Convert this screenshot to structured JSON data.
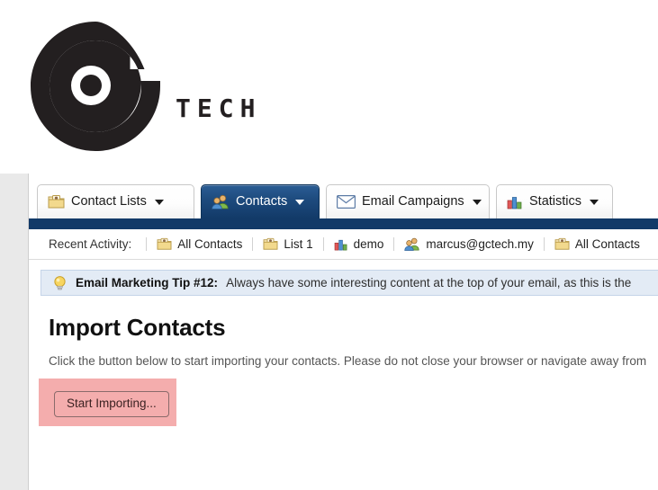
{
  "brand": {
    "logo_icon": "gtech-g-logo",
    "wordmark": "TECH"
  },
  "tabs": [
    {
      "label": "Contact Lists",
      "icon": "contact-list-folder-icon",
      "active": false,
      "has_caret": true
    },
    {
      "label": "Contacts",
      "icon": "contacts-people-icon",
      "active": true,
      "has_caret": true
    },
    {
      "label": "Email Campaigns",
      "icon": "envelope-icon",
      "active": false,
      "has_caret": true
    },
    {
      "label": "Statistics",
      "icon": "bar-chart-icon",
      "active": false,
      "has_caret": true
    }
  ],
  "recent_activity": {
    "label": "Recent Activity:",
    "items": [
      {
        "label": "All Contacts",
        "icon": "contact-list-folder-icon"
      },
      {
        "label": "List 1",
        "icon": "contact-list-folder-icon"
      },
      {
        "label": "demo",
        "icon": "bar-chart-icon"
      },
      {
        "label": "marcus@gctech.my",
        "icon": "contacts-people-icon"
      },
      {
        "label": "All Contacts",
        "icon": "contact-list-folder-icon"
      }
    ]
  },
  "tip": {
    "icon": "lightbulb-icon",
    "title": "Email Marketing Tip #12:",
    "body": "Always have some interesting content at the top of your email, as this is the"
  },
  "main": {
    "heading": "Import Contacts",
    "description": "Click the button below to start importing your contacts. Please do not close your browser or navigate away from",
    "primary_button": "Start Importing...",
    "highlight_color": "#f4adad"
  },
  "colors": {
    "active_tab": "#123a68",
    "navy_rule": "#123a68",
    "tip_bg": "#e3ebf5",
    "page_bg": "#e9e9e9"
  }
}
